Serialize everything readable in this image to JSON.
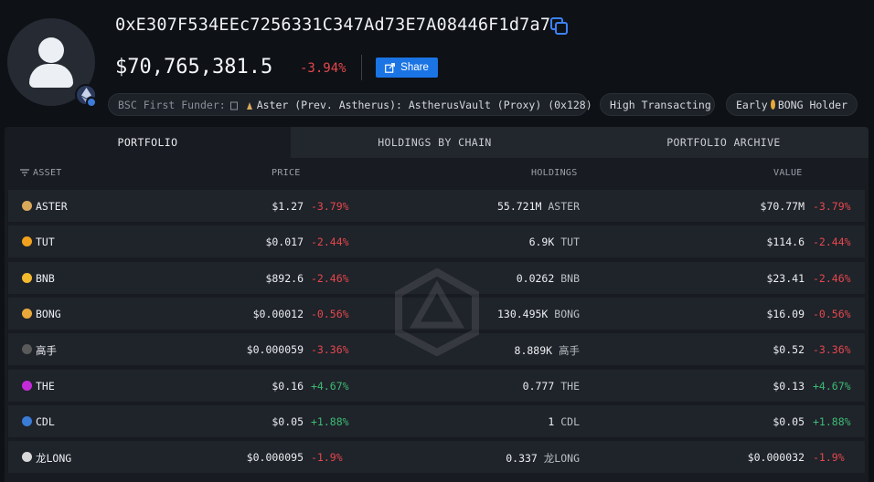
{
  "profile": {
    "address": "0xE307F534EEc7256331C347Ad73E7A08446F1d7a7",
    "balance": "$70,765,381.5",
    "change": "-3.94%",
    "share_label": "Share",
    "chain_icon": "ethereum-icon"
  },
  "tags": {
    "funder_label": "BSC First Funder:",
    "funder_value": "Aster (Prev. Astherus): AstherusVault (Proxy) (0x128)",
    "high_transacting": "High Transacting",
    "early_prefix": "Early",
    "early_suffix": "BONG Holder"
  },
  "tabs": [
    "PORTFOLIO",
    "HOLDINGS BY CHAIN",
    "PORTFOLIO ARCHIVE"
  ],
  "columns": {
    "asset": "ASSET",
    "price": "PRICE",
    "holdings": "HOLDINGS",
    "value": "VALUE"
  },
  "rows": [
    {
      "asset": "ASTER",
      "price": "$1.27",
      "price_change": "-3.79%",
      "holdings": "55.721M",
      "unit": "ASTER",
      "value": "$70.77M",
      "value_change": "-3.79%",
      "icon_color": "#d9a85a"
    },
    {
      "asset": "TUT",
      "price": "$0.017",
      "price_change": "-2.44%",
      "holdings": "6.9K",
      "unit": "TUT",
      "value": "$114.6",
      "value_change": "-2.44%",
      "icon_color": "#f0a21e"
    },
    {
      "asset": "BNB",
      "price": "$892.6",
      "price_change": "-2.46%",
      "holdings": "0.0262",
      "unit": "BNB",
      "value": "$23.41",
      "value_change": "-2.46%",
      "icon_color": "#f3ba2f"
    },
    {
      "asset": "BONG",
      "price": "$0.00012",
      "price_change": "-0.56%",
      "holdings": "130.495K",
      "unit": "BONG",
      "value": "$16.09",
      "value_change": "-0.56%",
      "icon_color": "#e8a93a"
    },
    {
      "asset": "高手",
      "price": "$0.000059",
      "price_change": "-3.36%",
      "holdings": "8.889K",
      "unit": "高手",
      "value": "$0.52",
      "value_change": "-3.36%",
      "icon_color": "#5a5a5a"
    },
    {
      "asset": "THE",
      "price": "$0.16",
      "price_change": "+4.67%",
      "holdings": "0.777",
      "unit": "THE",
      "value": "$0.13",
      "value_change": "+4.67%",
      "icon_color": "#c42bd8"
    },
    {
      "asset": "CDL",
      "price": "$0.05",
      "price_change": "+1.88%",
      "holdings": "1",
      "unit": "CDL",
      "value": "$0.05",
      "value_change": "+1.88%",
      "icon_color": "#3a7bd5"
    },
    {
      "asset": "龙LONG",
      "price": "$0.000095",
      "price_change": "-1.9%",
      "holdings": "0.337",
      "unit": "龙LONG",
      "value": "$0.000032",
      "value_change": "-1.9%",
      "icon_color": "#d8d8d8"
    }
  ]
}
